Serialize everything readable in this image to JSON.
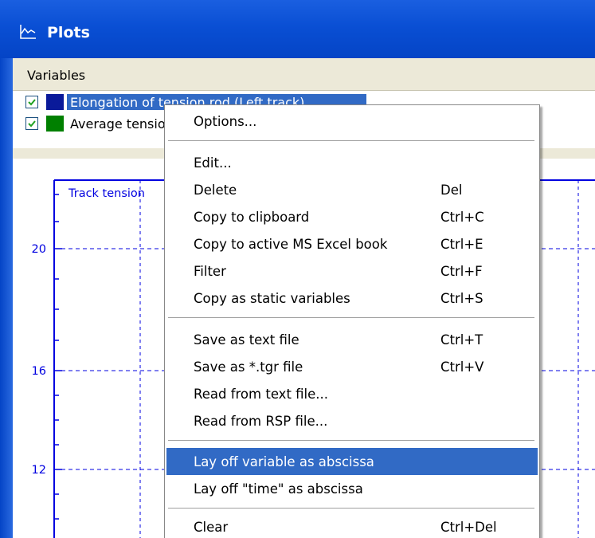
{
  "window": {
    "title": "Plots",
    "icon": "plot-curve-icon"
  },
  "variables": {
    "header": "Variables",
    "items": [
      {
        "label": "Elongation of tension rod (Left track)",
        "checked": true,
        "color": "#0a1a9a",
        "selected": true
      },
      {
        "label": "Average tension",
        "checked": true,
        "color": "#008000",
        "selected": false
      }
    ]
  },
  "plot": {
    "title": "Track tension",
    "y_ticks": [
      "20",
      "16",
      "12"
    ]
  },
  "context_menu": {
    "items": [
      {
        "label": "Options...",
        "shortcut": ""
      },
      {
        "label": "Edit...",
        "shortcut": ""
      },
      {
        "label": "Delete",
        "shortcut": "Del"
      },
      {
        "label": "Copy to clipboard",
        "shortcut": "Ctrl+C"
      },
      {
        "label": "Copy to active MS Excel book",
        "shortcut": "Ctrl+E"
      },
      {
        "label": "Filter",
        "shortcut": "Ctrl+F"
      },
      {
        "label": "Copy as static variables",
        "shortcut": "Ctrl+S"
      },
      {
        "label": "Save as text file",
        "shortcut": "Ctrl+T"
      },
      {
        "label": "Save as *.tgr file",
        "shortcut": "Ctrl+V"
      },
      {
        "label": "Read from text file...",
        "shortcut": ""
      },
      {
        "label": "Read from RSP file...",
        "shortcut": ""
      },
      {
        "label": "Lay off variable as abscissa",
        "shortcut": "",
        "highlighted": true
      },
      {
        "label": "Lay off \"time\" as abscissa",
        "shortcut": ""
      },
      {
        "label": "Clear",
        "shortcut": "Ctrl+Del"
      }
    ]
  },
  "colors": {
    "titlebar": "#0a4fd4",
    "plot_axis": "#0000e0",
    "highlight": "#316ac5"
  }
}
